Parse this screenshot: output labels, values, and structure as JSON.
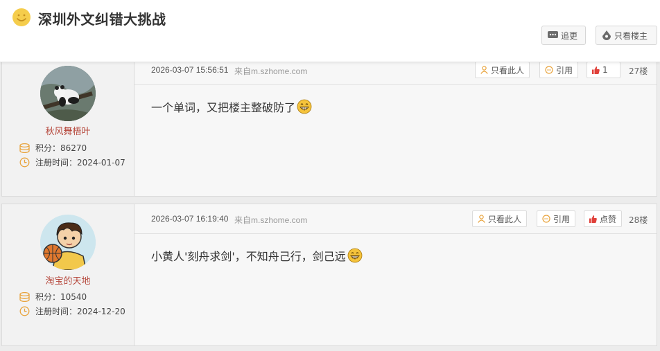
{
  "header": {
    "title": "深圳外文纠错大挑战",
    "follow_label": "追更",
    "only_op_label": "只看楼主"
  },
  "posts": [
    {
      "username": "秋风舞梧叶",
      "points_label": "积分：",
      "points": "86270",
      "reg_label": "注册时间：",
      "reg_date": "2024-01-07",
      "time": "2026-03-07 15:56:51",
      "source": "来自m.szhome.com",
      "only_this_label": "只看此人",
      "quote_label": "引用",
      "like_label": "1",
      "floor": "27楼",
      "content": "一个单词，又把楼主整破防了"
    },
    {
      "username": "淘宝的天地",
      "points_label": "积分：",
      "points": "10540",
      "reg_label": "注册时间：",
      "reg_date": "2024-12-20",
      "time": "2026-03-07 16:19:40",
      "source": "来自m.szhome.com",
      "only_this_label": "只看此人",
      "quote_label": "引用",
      "like_label": "点赞",
      "floor": "28楼",
      "content": "小黄人'刻舟求剑'，不知舟己行，剑己远"
    }
  ],
  "icons": {
    "title": "smiley-face-icon",
    "follow": "chat-bubble-icon",
    "only_op": "drop-person-icon",
    "points": "coin-stack-icon",
    "reg": "clock-icon",
    "only_this": "person-icon",
    "quote": "quote-bubble-icon",
    "like": "thumbs-up-icon",
    "emoji": "grin-emoji-icon"
  },
  "colors": {
    "accent_red": "#e0403a",
    "icon_orange": "#e8a33c",
    "username": "#b5463a"
  }
}
